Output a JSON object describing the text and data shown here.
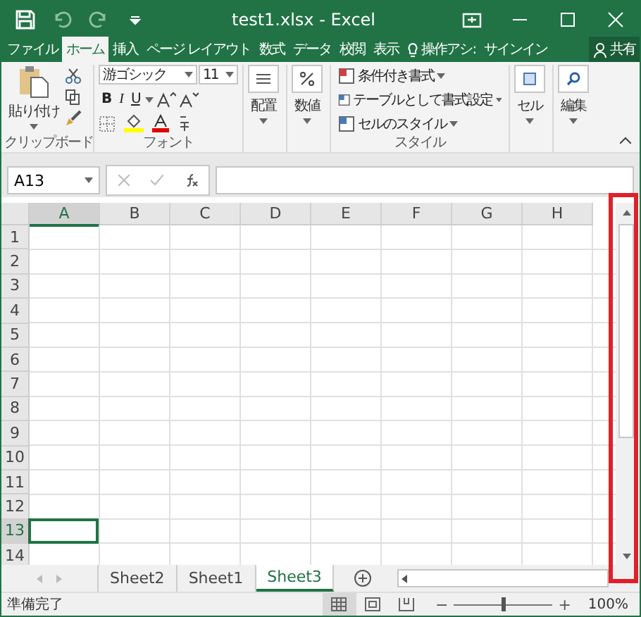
{
  "window": {
    "title": "test1.xlsx - Excel"
  },
  "ribbon_tabs": [
    {
      "label": "ファイル",
      "selected": false,
      "kind": "file"
    },
    {
      "label": "ホーム",
      "selected": true,
      "kind": "tab"
    },
    {
      "label": "挿入",
      "selected": false,
      "kind": "tab"
    },
    {
      "label": "ページ レイアウト",
      "selected": false,
      "kind": "tab"
    },
    {
      "label": "数式",
      "selected": false,
      "kind": "tab"
    },
    {
      "label": "データ",
      "selected": false,
      "kind": "tab"
    },
    {
      "label": "校閲",
      "selected": false,
      "kind": "tab"
    },
    {
      "label": "表示",
      "selected": false,
      "kind": "tab"
    },
    {
      "label": "操作アシ:",
      "selected": false,
      "kind": "tellme"
    },
    {
      "label": "サインイン",
      "selected": false,
      "kind": "tab"
    },
    {
      "label": "共有",
      "selected": false,
      "kind": "share"
    }
  ],
  "ribbon": {
    "paste": "貼り付け",
    "clipboard_label": "クリップボード",
    "font_name": "游ゴシック",
    "font_size": "11",
    "bold": "B",
    "italic": "I",
    "underline": "U",
    "font_label": "フォント",
    "alignment": "配置",
    "number": "数値",
    "styles": [
      "条件付き書式",
      "テーブルとして書式設定",
      "セルのスタイル"
    ],
    "styles_label": "スタイル",
    "cells": "セル",
    "editing": "編集"
  },
  "formula_bar": {
    "name_box": "A13"
  },
  "columns": [
    {
      "label": "A",
      "selected": true
    },
    {
      "label": "B",
      "selected": false
    },
    {
      "label": "C",
      "selected": false
    },
    {
      "label": "D",
      "selected": false
    },
    {
      "label": "E",
      "selected": false
    },
    {
      "label": "F",
      "selected": false
    },
    {
      "label": "G",
      "selected": false
    },
    {
      "label": "H",
      "selected": false
    }
  ],
  "rows": [
    {
      "label": "1",
      "selected": false
    },
    {
      "label": "2",
      "selected": false
    },
    {
      "label": "3",
      "selected": false
    },
    {
      "label": "4",
      "selected": false
    },
    {
      "label": "5",
      "selected": false
    },
    {
      "label": "6",
      "selected": false
    },
    {
      "label": "7",
      "selected": false
    },
    {
      "label": "8",
      "selected": false
    },
    {
      "label": "9",
      "selected": false
    },
    {
      "label": "10",
      "selected": false
    },
    {
      "label": "11",
      "selected": false
    },
    {
      "label": "12",
      "selected": false
    },
    {
      "label": "13",
      "selected": true
    },
    {
      "label": "14",
      "selected": false
    }
  ],
  "vertical_scrollbar": {
    "highlighted": true
  },
  "sheet_tabs": [
    {
      "label": "Sheet2",
      "selected": false
    },
    {
      "label": "Sheet1",
      "selected": false
    },
    {
      "label": "Sheet3",
      "selected": true
    }
  ],
  "status_bar": {
    "text": "準備完了",
    "zoom_out": "−",
    "zoom_in": "+",
    "zoom": "100%",
    "zoom_level": {
      "level": 0.5
    },
    "views": [
      {
        "kind": "normal",
        "selected": true
      },
      {
        "kind": "layout",
        "selected": false
      },
      {
        "kind": "pagebreak",
        "selected": false
      }
    ]
  }
}
